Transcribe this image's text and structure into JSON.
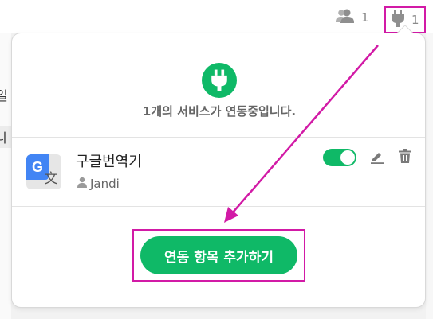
{
  "topbar": {
    "members_count": "1",
    "integrations_count": "1"
  },
  "background": {
    "left_chars": [
      "일",
      "니"
    ]
  },
  "panel": {
    "status_text": "1개의 서비스가 연동중입니다.",
    "service": {
      "name": "구글번역기",
      "owner": "Jandi",
      "enabled": true,
      "icon_glyph_g": "G",
      "icon_glyph_t": "文"
    },
    "add_button_label": "연동 항목 추가하기"
  },
  "colors": {
    "accent_green": "#0fb967",
    "highlight_magenta": "#d21aa6"
  }
}
